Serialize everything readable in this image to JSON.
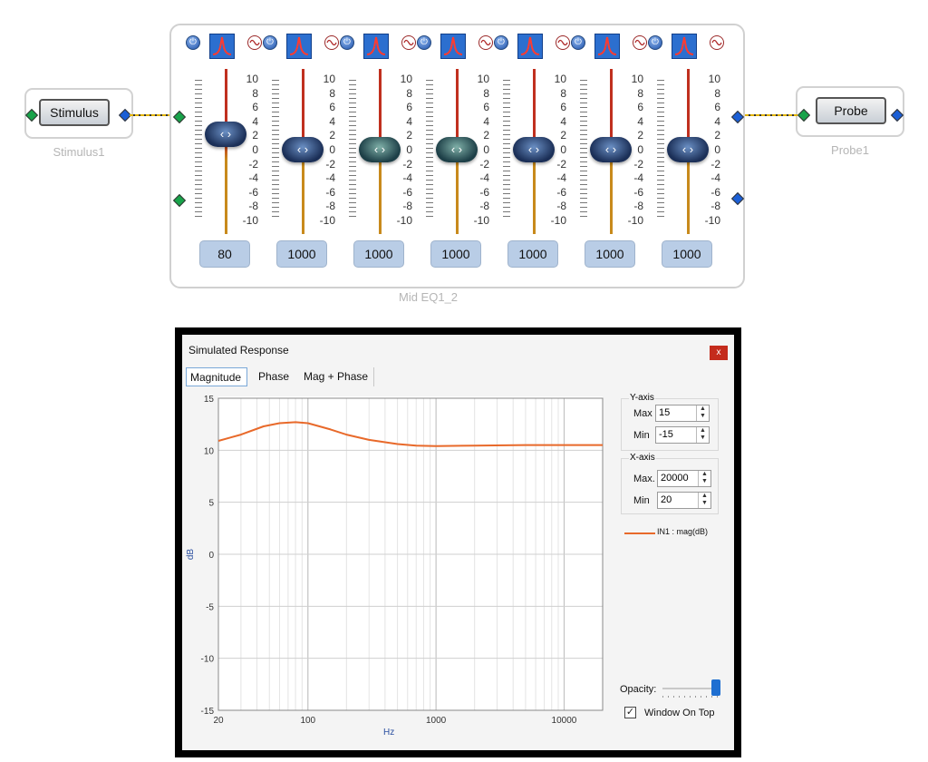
{
  "stimulus_block": {
    "button_label": "Stimulus",
    "name": "Stimulus1"
  },
  "probe_block": {
    "button_label": "Probe",
    "name": "Probe1"
  },
  "eq": {
    "name": "Mid EQ1_2",
    "scale_labels": [
      "10",
      "8",
      "6",
      "4",
      "2",
      "0",
      "-2",
      "-4",
      "-6",
      "-8",
      "-10"
    ],
    "bands": [
      {
        "freq": "80",
        "gain_db": 2.2,
        "knob_style": "blue"
      },
      {
        "freq": "1000",
        "gain_db": 0,
        "knob_style": "blue"
      },
      {
        "freq": "1000",
        "gain_db": 0,
        "knob_style": "teal"
      },
      {
        "freq": "1000",
        "gain_db": 0,
        "knob_style": "teal"
      },
      {
        "freq": "1000",
        "gain_db": 0,
        "knob_style": "blue"
      },
      {
        "freq": "1000",
        "gain_db": 0,
        "knob_style": "blue"
      },
      {
        "freq": "1000",
        "gain_db": 0,
        "knob_style": "blue"
      }
    ],
    "icons": [
      "power-icon",
      "peak-filter-icon",
      "wave-icon"
    ]
  },
  "dialog": {
    "title": "Simulated Response",
    "close_label": "x",
    "tabs": [
      "Magnitude",
      "Phase",
      "Mag + Phase"
    ],
    "active_tab": "Magnitude",
    "yaxis": {
      "title": "Y-axis",
      "max_label": "Max",
      "max": "15",
      "min_label": "Min",
      "min": "-15"
    },
    "xaxis": {
      "title": "X-axis",
      "max_label": "Max.",
      "max": "20000",
      "min_label": "Min",
      "min": "20"
    },
    "opacity_label": "Opacity:",
    "opacity_value": 0.95,
    "window_on_top_label": "Window On Top",
    "window_on_top_checked": true
  },
  "chart_data": {
    "type": "line",
    "xlabel": "Hz",
    "ylabel": "dB",
    "xscale": "log",
    "xlim": [
      20,
      20000
    ],
    "ylim": [
      -15,
      15
    ],
    "xticks": [
      "20",
      "100",
      "1000",
      "10000"
    ],
    "yticks": [
      "15",
      "10",
      "5",
      "0",
      "-5",
      "-10",
      "-15"
    ],
    "grid": true,
    "series": [
      {
        "name": "IN1 : mag(dB)",
        "color": "#e8692a",
        "x": [
          20,
          30,
          45,
          60,
          80,
          100,
          150,
          200,
          300,
          500,
          700,
          1000,
          2000,
          5000,
          10000,
          20000
        ],
        "y": [
          10.9,
          11.5,
          12.3,
          12.6,
          12.7,
          12.6,
          12.0,
          11.5,
          11.0,
          10.6,
          10.45,
          10.4,
          10.45,
          10.5,
          10.5,
          10.5
        ]
      }
    ]
  }
}
